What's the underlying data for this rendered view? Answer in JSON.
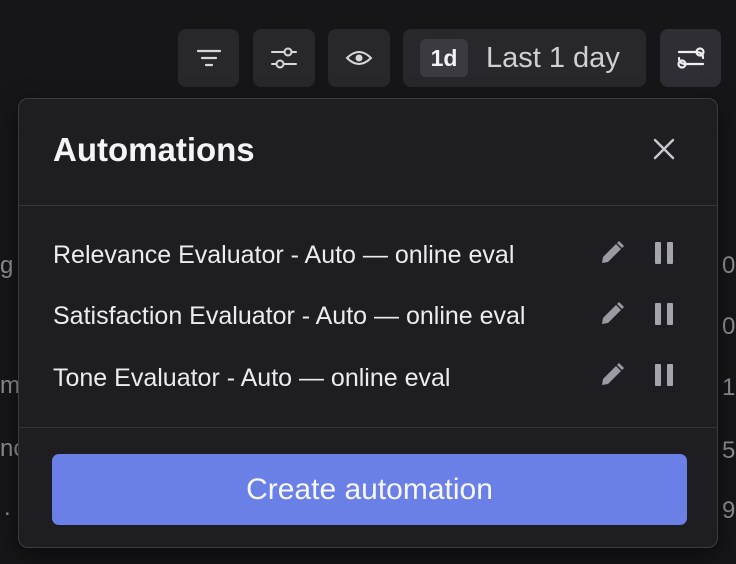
{
  "toolbar": {
    "range_badge": "1d",
    "range_label": "Last 1 day"
  },
  "background_fragments": [
    "g",
    "m",
    "nc",
    ".",
    "0",
    "0",
    "1",
    "5",
    "9"
  ],
  "popover": {
    "title": "Automations",
    "automations": [
      {
        "name": "Relevance Evaluator - Auto — online eval"
      },
      {
        "name": "Satisfaction Evaluator - Auto — online eval"
      },
      {
        "name": "Tone Evaluator - Auto — online eval"
      }
    ],
    "create_label": "Create automation"
  },
  "colors": {
    "background": "#161619",
    "popover": "#1e1e22",
    "accent": "#6b80e6"
  }
}
